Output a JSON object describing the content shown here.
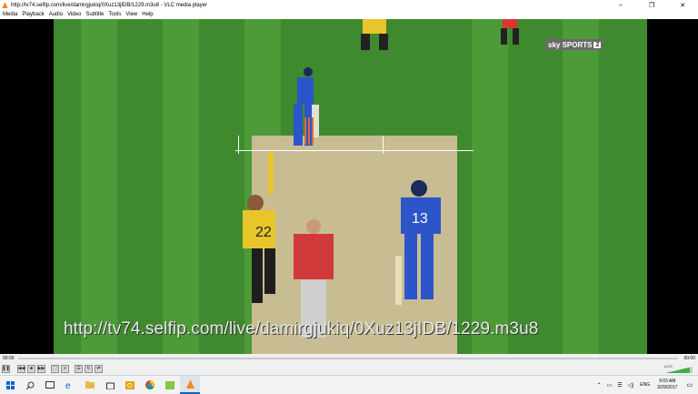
{
  "window": {
    "title": "http://tv74.selfip.com/live/damirgjukiq/0Xuz13jIDB/1229.m3u8 - VLC media player",
    "min_glyph": "–",
    "max_glyph": "❐",
    "close_glyph": "✕"
  },
  "menu": [
    "Media",
    "Playback",
    "Audio",
    "Video",
    "Subtitle",
    "Tools",
    "View",
    "Help"
  ],
  "video": {
    "overlay_url": "http://tv74.selfip.com/live/damirgjukiq/0Xuz13jIDB/1229.m3u8",
    "channel_logo": "sky SPORTS",
    "channel_number": "2",
    "player_numbers": [
      "22",
      "13"
    ]
  },
  "controls": {
    "elapsed": "00:00",
    "total": "00:00",
    "volume_percent": "112%",
    "volume_level": 1.12
  },
  "taskbar": {
    "time": "9:03 AM",
    "date": "3/29/2017",
    "language": "ENG"
  },
  "colors": {
    "vlc_orange": "#f08a1c",
    "win_blue": "#0a64c8",
    "volume_green": "#3cb043"
  }
}
